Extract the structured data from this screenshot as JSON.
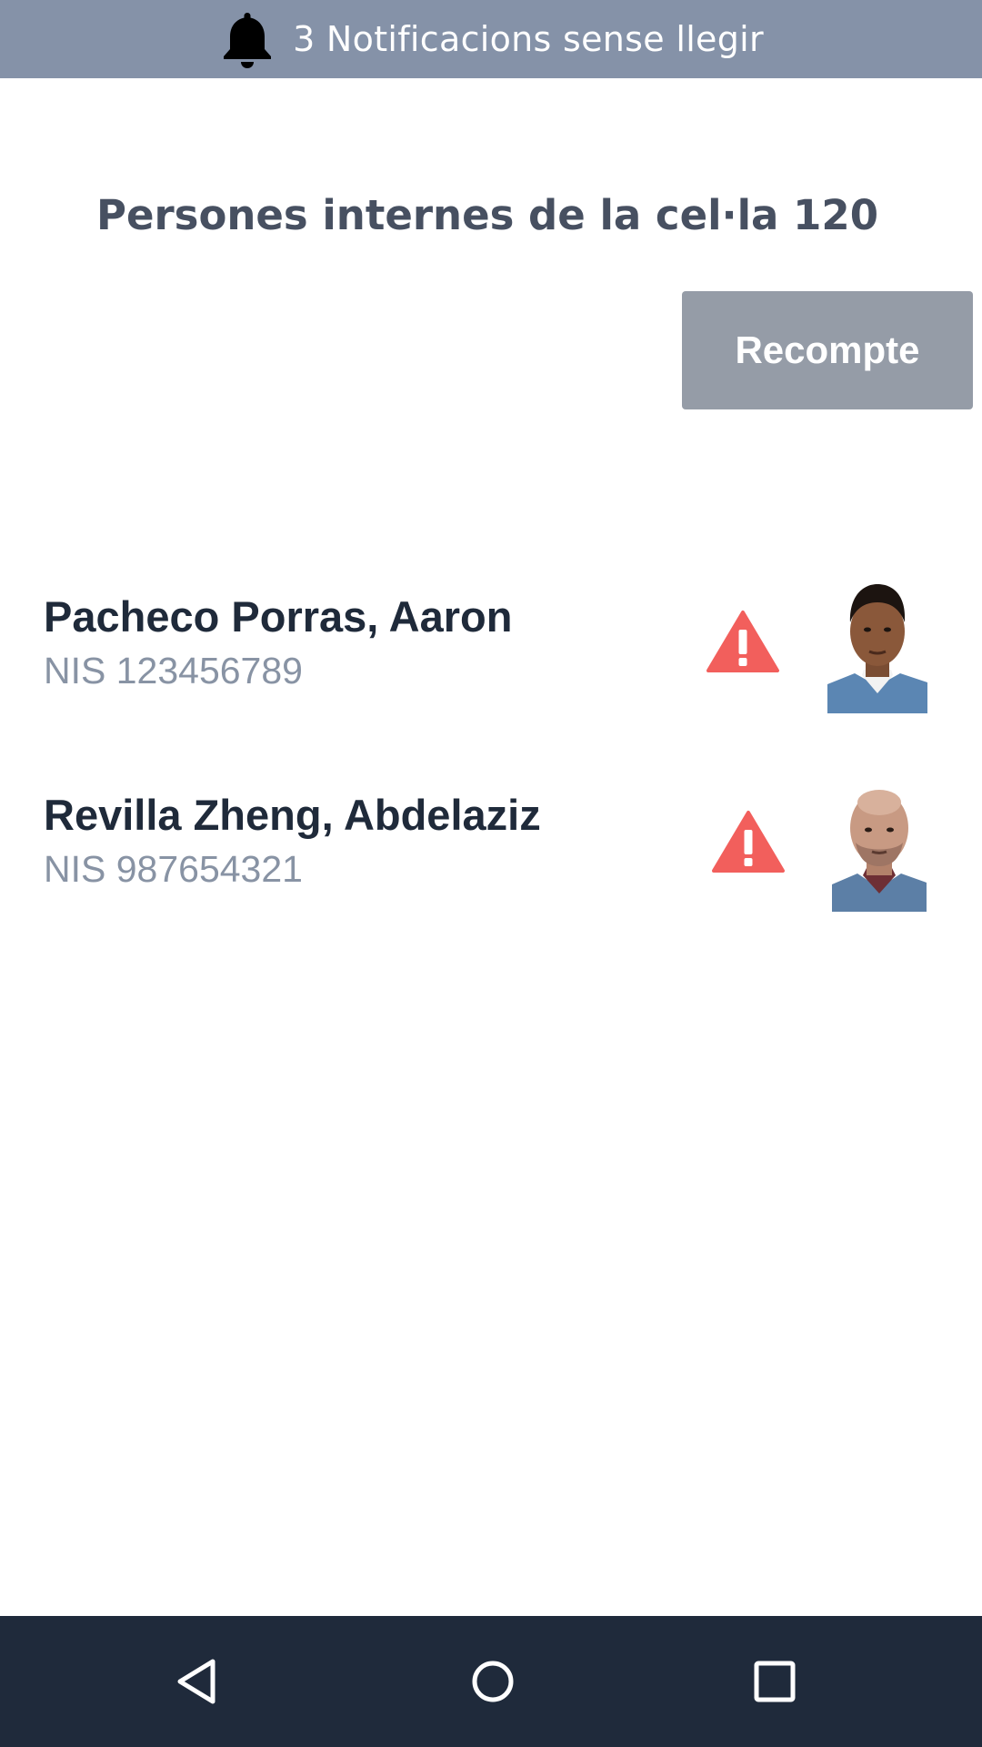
{
  "notification_bar": {
    "text": "3 Notificacions sense llegir",
    "icon": "bell-icon"
  },
  "page": {
    "title": "Persones internes de la cel·la 120",
    "recount_label": "Recompte"
  },
  "persons": [
    {
      "name": "Pacheco Porras, Aaron",
      "nis": "NIS 123456789",
      "alert_icon": "warning-icon",
      "photo": "person-photo"
    },
    {
      "name": "Revilla Zheng, Abdelaziz",
      "nis": "NIS 987654321",
      "alert_icon": "warning-icon",
      "photo": "person-photo"
    }
  ],
  "nav_bar": {
    "back_icon": "back-triangle-icon",
    "home_icon": "home-circle-icon",
    "recents_icon": "recents-square-icon"
  },
  "colors": {
    "notification_bg": "#8592a8",
    "title": "#475061",
    "button_bg": "#959ca7",
    "name": "#1f2a3a",
    "nis": "#8893a4",
    "alert": "#f25f5c",
    "nav_bg": "#1f2a3b"
  }
}
